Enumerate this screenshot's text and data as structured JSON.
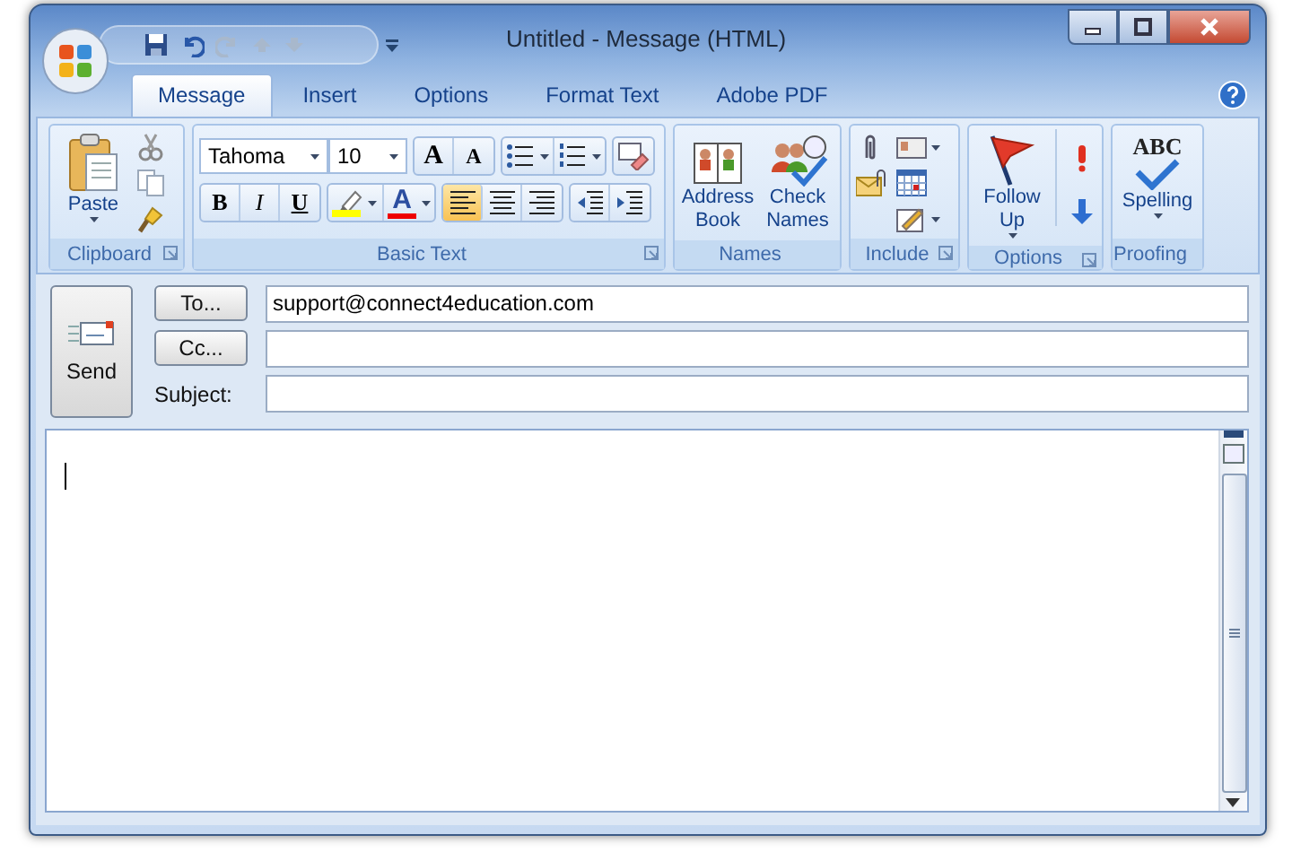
{
  "window": {
    "title": "Untitled - Message (HTML)"
  },
  "tabs": [
    {
      "label": "Message",
      "selected": true
    },
    {
      "label": "Insert",
      "selected": false
    },
    {
      "label": "Options",
      "selected": false
    },
    {
      "label": "Format Text",
      "selected": false
    },
    {
      "label": "Adobe PDF",
      "selected": false
    }
  ],
  "ribbon": {
    "groups": [
      {
        "kind": "clipboard",
        "label": "Clipboard",
        "launcher": true,
        "buttons": [
          {
            "label": "Paste"
          }
        ]
      },
      {
        "kind": "basic_text",
        "label": "Basic Text",
        "launcher": true,
        "font": "Tahoma",
        "size": "10",
        "size_buttons": [
          "A",
          "A"
        ],
        "format_buttons": [
          "B",
          "I",
          "U"
        ],
        "font_color_button": "A",
        "alignment": [
          {
            "kind": "left",
            "selected": true
          },
          {
            "kind": "center",
            "selected": false
          },
          {
            "kind": "right",
            "selected": false
          }
        ]
      },
      {
        "kind": "names",
        "label": "Names",
        "launcher": false,
        "buttons": [
          {
            "label": "Address Book"
          },
          {
            "label": "Check Names"
          }
        ]
      },
      {
        "kind": "include",
        "label": "Include",
        "launcher": true
      },
      {
        "kind": "options",
        "label": "Options",
        "launcher": true,
        "buttons": [
          {
            "label": "Follow Up"
          }
        ]
      },
      {
        "kind": "proofing",
        "label": "Proofing",
        "launcher": false,
        "icon_text": "ABC",
        "buttons": [
          {
            "label": "Spelling"
          }
        ]
      }
    ]
  },
  "compose": {
    "send": "Send",
    "to_button": "To...",
    "to_value": "support@connect4education.com",
    "cc_button": "Cc...",
    "subject_label": "Subject:"
  }
}
